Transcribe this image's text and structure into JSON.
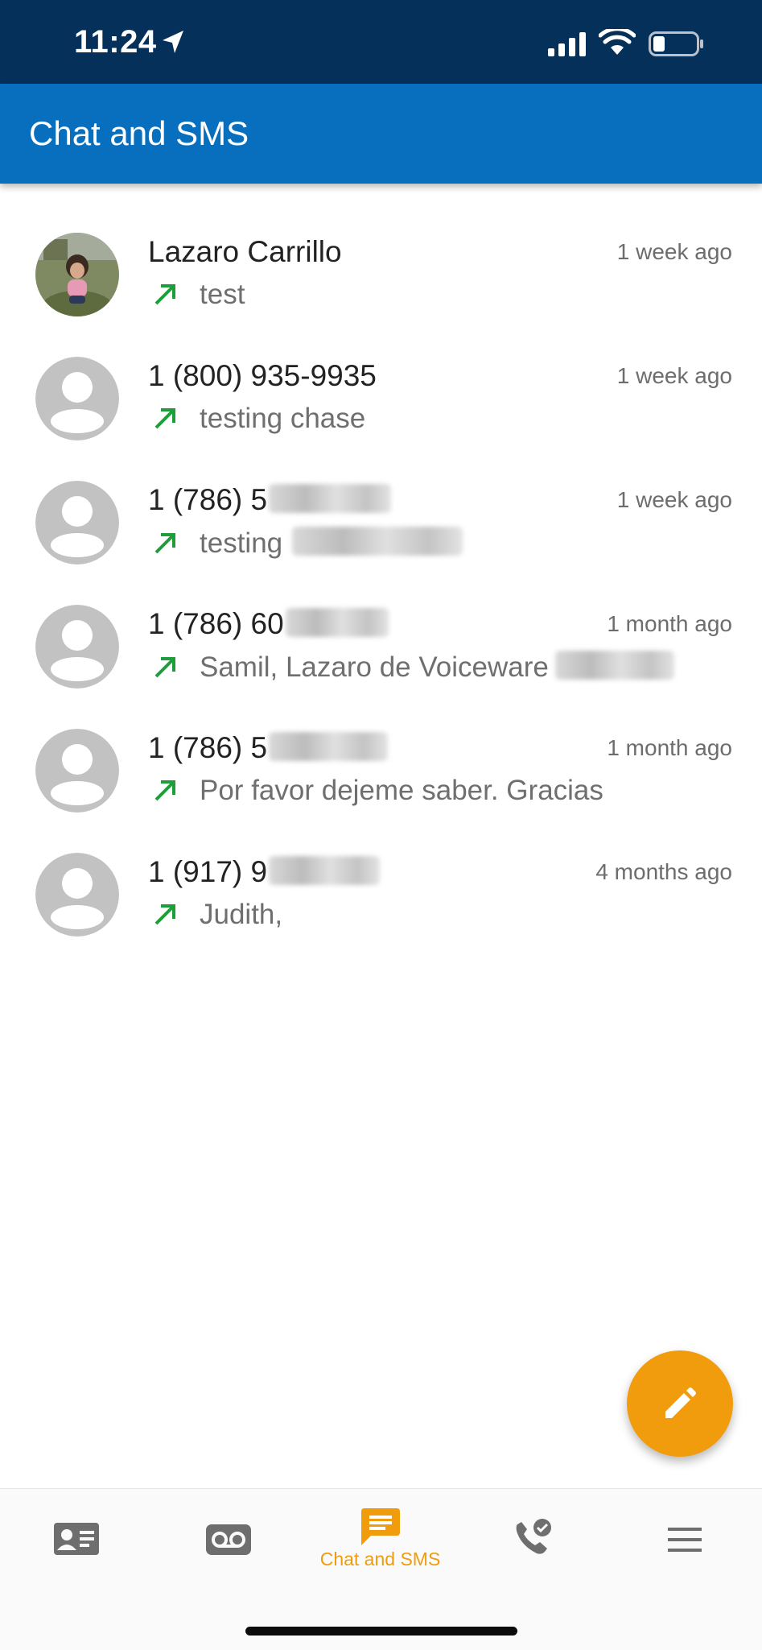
{
  "status_bar": {
    "time": "11:24",
    "icons": [
      "location-arrow-icon",
      "cellular-signal-icon",
      "wifi-icon",
      "battery-icon"
    ]
  },
  "app_bar": {
    "title": "Chat and SMS"
  },
  "conversations": [
    {
      "name": "Lazaro Carrillo",
      "time": "1 week ago",
      "preview": "test",
      "direction": "outgoing",
      "avatar": "photo"
    },
    {
      "name": "1 (800) 935-9935",
      "time": "1 week ago",
      "preview": "testing chase",
      "direction": "outgoing",
      "avatar": "placeholder"
    },
    {
      "name": "1 (786) 5",
      "time": "1 week ago",
      "preview": "testing",
      "direction": "outgoing",
      "avatar": "placeholder"
    },
    {
      "name": "1 (786) 60",
      "time": "1 month ago",
      "preview": "Samil, Lazaro de Voiceware",
      "direction": "outgoing",
      "avatar": "placeholder"
    },
    {
      "name": "1 (786) 5",
      "time": "1 month ago",
      "preview": "Por favor dejeme saber. Gracias",
      "direction": "outgoing",
      "avatar": "placeholder"
    },
    {
      "name": "1 (917) 9",
      "time": "4 months ago",
      "preview": "Judith,",
      "direction": "outgoing",
      "avatar": "placeholder"
    }
  ],
  "fab": {
    "icon": "pencil-icon"
  },
  "bottom_nav": {
    "items": [
      {
        "icon": "contacts-card-icon",
        "label": ""
      },
      {
        "icon": "voicemail-icon",
        "label": ""
      },
      {
        "icon": "chat-icon",
        "label": "Chat and SMS",
        "active": true
      },
      {
        "icon": "phone-check-icon",
        "label": ""
      },
      {
        "icon": "menu-icon",
        "label": ""
      }
    ]
  },
  "colors": {
    "status_bar": "#04305a",
    "app_bar": "#086fbe",
    "accent": "#f09c0c",
    "outgoing_arrow": "#1e9e3a",
    "inactive_icon": "#6e6e6e"
  }
}
